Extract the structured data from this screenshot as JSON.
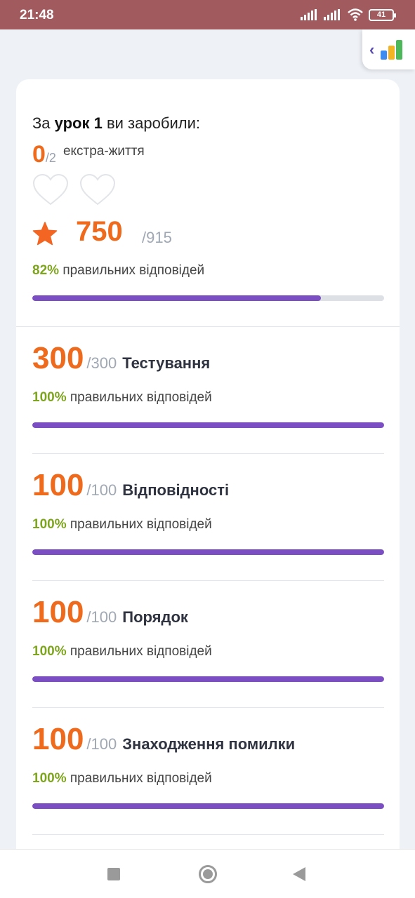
{
  "status": {
    "time": "21:48",
    "battery": "41"
  },
  "summary": {
    "prefix": "За",
    "lesson": "урок 1",
    "suffix": "ви заробили:",
    "lives_num": "0",
    "lives_den": "/2",
    "lives_label": "екстра-життя",
    "score": "750",
    "score_total": "/915",
    "pct_value": "82%",
    "pct_label": "правильних відповідей",
    "progress": 0.82
  },
  "sections": [
    {
      "score": "300",
      "total": "/300",
      "title": "Тестування",
      "pct_value": "100%",
      "pct_label": "правильних відповідей",
      "progress": 1.0
    },
    {
      "score": "100",
      "total": "/100",
      "title": "Відповідності",
      "pct_value": "100%",
      "pct_label": "правильних відповідей",
      "progress": 1.0
    },
    {
      "score": "100",
      "total": "/100",
      "title": "Порядок",
      "pct_value": "100%",
      "pct_label": "правильних відповідей",
      "progress": 1.0
    },
    {
      "score": "100",
      "total": "/100",
      "title": "Знаходження помилки",
      "pct_value": "100%",
      "pct_label": "правильних відповідей",
      "progress": 1.0
    }
  ],
  "colors": {
    "accent": "#ee6a1d",
    "progress": "#7b4fc3",
    "success": "#7ea51e",
    "status_bar": "#a15b5f"
  },
  "icons": {
    "side_tab": [
      "chevron-left-icon",
      "bar-chart-icon"
    ],
    "lives": "heart-outline-icon",
    "score": "star-icon"
  }
}
